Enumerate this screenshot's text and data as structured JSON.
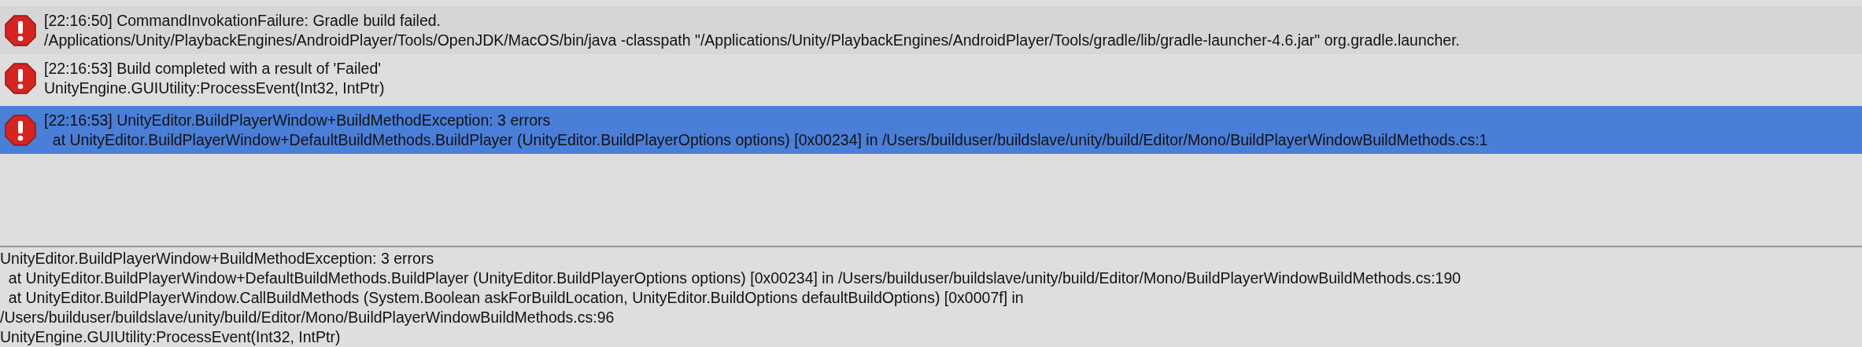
{
  "log_entries": [
    {
      "kind": "error",
      "selected": false,
      "lines": [
        "[22:16:50] CommandInvokationFailure: Gradle build failed.",
        "/Applications/Unity/PlaybackEngines/AndroidPlayer/Tools/OpenJDK/MacOS/bin/java -classpath \"/Applications/Unity/PlaybackEngines/AndroidPlayer/Tools/gradle/lib/gradle-launcher-4.6.jar\" org.gradle.launcher."
      ]
    },
    {
      "kind": "error",
      "selected": false,
      "lines": [
        "[22:16:53] Build completed with a result of 'Failed'",
        "UnityEngine.GUIUtility:ProcessEvent(Int32, IntPtr)"
      ]
    },
    {
      "kind": "error",
      "selected": true,
      "lines": [
        "[22:16:53] UnityEditor.BuildPlayerWindow+BuildMethodException: 3 errors",
        "  at UnityEditor.BuildPlayerWindow+DefaultBuildMethods.BuildPlayer (UnityEditor.BuildPlayerOptions options) [0x00234] in /Users/builduser/buildslave/unity/build/Editor/Mono/BuildPlayerWindowBuildMethods.cs:1"
      ]
    }
  ],
  "details": [
    "UnityEditor.BuildPlayerWindow+BuildMethodException: 3 errors",
    "  at UnityEditor.BuildPlayerWindow+DefaultBuildMethods.BuildPlayer (UnityEditor.BuildPlayerOptions options) [0x00234] in /Users/builduser/buildslave/unity/build/Editor/Mono/BuildPlayerWindowBuildMethods.cs:190",
    "  at UnityEditor.BuildPlayerWindow.CallBuildMethods (System.Boolean askForBuildLocation, UnityEditor.BuildOptions defaultBuildOptions) [0x0007f] in",
    "/Users/builduser/buildslave/unity/build/Editor/Mono/BuildPlayerWindowBuildMethods.cs:96",
    "UnityEngine.GUIUtility:ProcessEvent(Int32, IntPtr)"
  ]
}
